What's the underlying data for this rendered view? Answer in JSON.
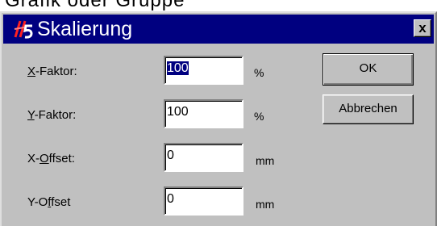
{
  "background_window": {
    "partial_title": "Grafik oder Gruppe"
  },
  "dialog": {
    "title": "Skalierung",
    "icon": "rs-app-logo-icon",
    "close_label": "x"
  },
  "fields": [
    {
      "label_acc": "X",
      "label_rest": "-Faktor:",
      "value": "100",
      "unit": "%"
    },
    {
      "label_acc": "Y",
      "label_rest": "-Faktor:",
      "value": "100",
      "unit": "%"
    },
    {
      "label_pre": "X-",
      "label_acc": "O",
      "label_rest": "ffset:",
      "value": "0",
      "unit": "mm"
    },
    {
      "label_pre": "Y-O",
      "label_acc": "f",
      "label_rest": "fset",
      "value": "0",
      "unit": "mm"
    }
  ],
  "buttons": {
    "ok": "OK",
    "cancel": "Abbrechen"
  },
  "colors": {
    "titlebar": "#000080",
    "face": "#c0c0c0",
    "selection": "#000080"
  }
}
